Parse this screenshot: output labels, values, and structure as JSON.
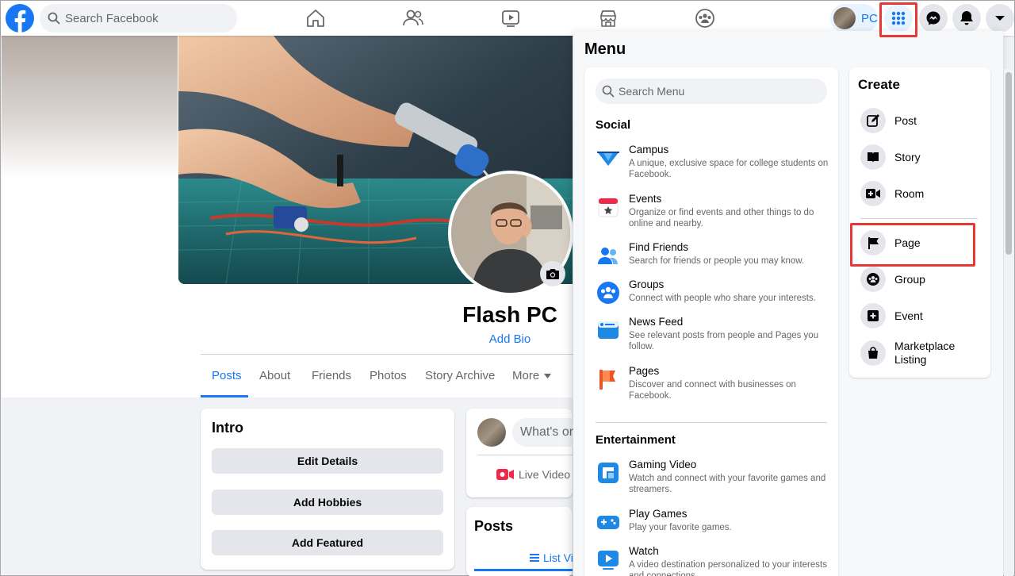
{
  "topbar": {
    "search_placeholder": "Search Facebook",
    "profile_chip_label": "PC"
  },
  "profile": {
    "name": "Flash PC",
    "add_bio": "Add Bio",
    "tabs": [
      "Posts",
      "About",
      "Friends",
      "Photos",
      "Story Archive",
      "More"
    ]
  },
  "intro": {
    "title": "Intro",
    "buttons": [
      "Edit Details",
      "Add Hobbies",
      "Add Featured"
    ]
  },
  "composer": {
    "placeholder": "What's on",
    "live_video": "Live Video"
  },
  "posts_card": {
    "title": "Posts",
    "list_view": "List Vi"
  },
  "menu": {
    "title": "Menu",
    "search_placeholder": "Search Menu",
    "sections": [
      {
        "title": "Social",
        "items": [
          {
            "title": "Campus",
            "desc": "A unique, exclusive space for college students on Facebook.",
            "icon": "campus-icon"
          },
          {
            "title": "Events",
            "desc": "Organize or find events and other things to do online and nearby.",
            "icon": "events-icon"
          },
          {
            "title": "Find Friends",
            "desc": "Search for friends or people you may know.",
            "icon": "find-friends-icon"
          },
          {
            "title": "Groups",
            "desc": "Connect with people who share your interests.",
            "icon": "groups-icon"
          },
          {
            "title": "News Feed",
            "desc": "See relevant posts from people and Pages you follow.",
            "icon": "news-feed-icon"
          },
          {
            "title": "Pages",
            "desc": "Discover and connect with businesses on Facebook.",
            "icon": "pages-icon"
          }
        ]
      },
      {
        "title": "Entertainment",
        "items": [
          {
            "title": "Gaming Video",
            "desc": "Watch and connect with your favorite games and streamers.",
            "icon": "gaming-video-icon"
          },
          {
            "title": "Play Games",
            "desc": "Play your favorite games.",
            "icon": "play-games-icon"
          },
          {
            "title": "Watch",
            "desc": "A video destination personalized to your interests and connections.",
            "icon": "watch-icon"
          }
        ]
      }
    ],
    "create": {
      "title": "Create",
      "items": [
        "Post",
        "Story",
        "Room",
        "Page",
        "Group",
        "Event",
        "Marketplace Listing"
      ]
    }
  },
  "colors": {
    "brand": "#1877f2",
    "highlight": "#e53935"
  }
}
